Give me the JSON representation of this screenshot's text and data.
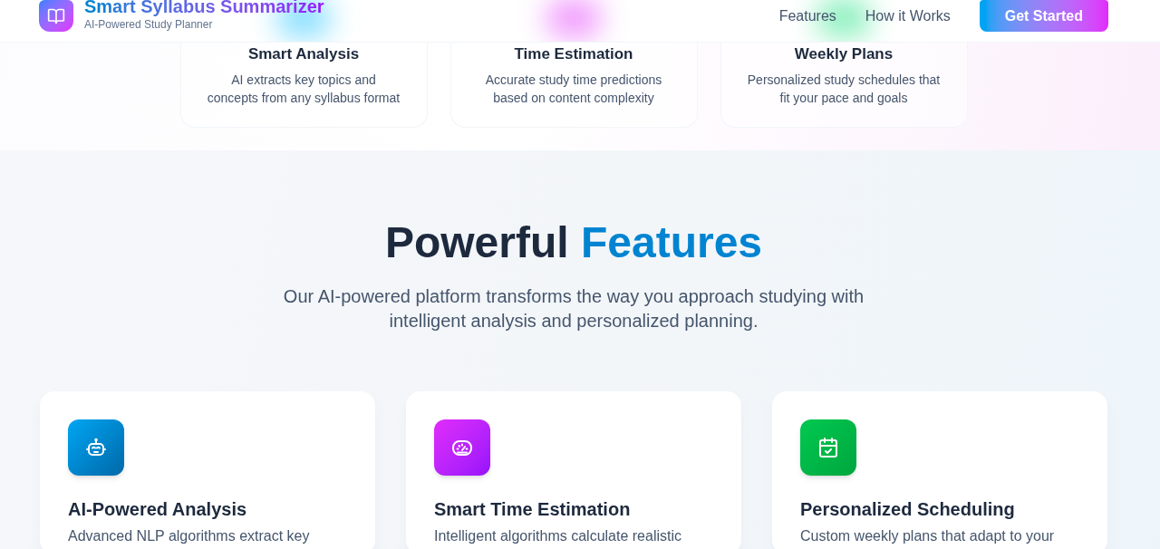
{
  "header": {
    "logo_title": "Smart Syllabus Summarizer",
    "logo_subtitle": "AI-Powered Study Planner",
    "nav_links": [
      "Features",
      "How it Works"
    ],
    "cta_button": "Get Started"
  },
  "hero_cards": [
    {
      "kind": "analysis",
      "title": "Smart Analysis",
      "description": "AI extracts key topics and concepts from any syllabus format"
    },
    {
      "kind": "time",
      "title": "Time Estimation",
      "description": "Accurate study time predictions based on content complexity"
    },
    {
      "kind": "plans",
      "title": "Weekly Plans",
      "description": "Personalized study schedules that fit your pace and goals"
    }
  ],
  "features_section": {
    "heading": "Powerful",
    "heading_highlight": "Features",
    "subtitle": "Our AI-powered platform transforms the way you approach studying with intelligent analysis and personalized planning.",
    "cards": [
      {
        "kind": "robot",
        "title": "AI-Powered Analysis",
        "description": "Advanced NLP algorithms extract key"
      },
      {
        "kind": "gauge",
        "title": "Smart Time Estimation",
        "description": "Intelligent algorithms calculate realistic"
      },
      {
        "kind": "calendar",
        "title": "Personalized Scheduling",
        "description": "Custom weekly plans that adapt to your"
      }
    ]
  }
}
